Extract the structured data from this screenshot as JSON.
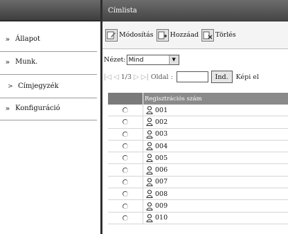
{
  "sidebar": {
    "items": [
      {
        "label": "Állapot",
        "chevron": "»"
      },
      {
        "label": "Munk.",
        "chevron": "»"
      },
      {
        "label": "Címjegyzék",
        "chevron": ">"
      },
      {
        "label": "Konfiguráció",
        "chevron": "»"
      }
    ]
  },
  "header": {
    "title": "Címlista"
  },
  "toolbar": {
    "edit_label": "Módosítás",
    "add_label": "Hozzáad",
    "delete_label": "Törlés"
  },
  "filter": {
    "label": "Nézet:",
    "selected": "Mind"
  },
  "pager": {
    "first": "|◁",
    "prev": "◁",
    "page_count": "1/3",
    "next": "▷",
    "last": "▷|",
    "page_label": "Oldal :",
    "page_input_value": "",
    "go_label": "Ind.",
    "trailing_text": "Képi el"
  },
  "table": {
    "header": "Regisztrációs szám",
    "rows": [
      "001",
      "002",
      "003",
      "004",
      "005",
      "006",
      "007",
      "008",
      "009",
      "010"
    ]
  }
}
